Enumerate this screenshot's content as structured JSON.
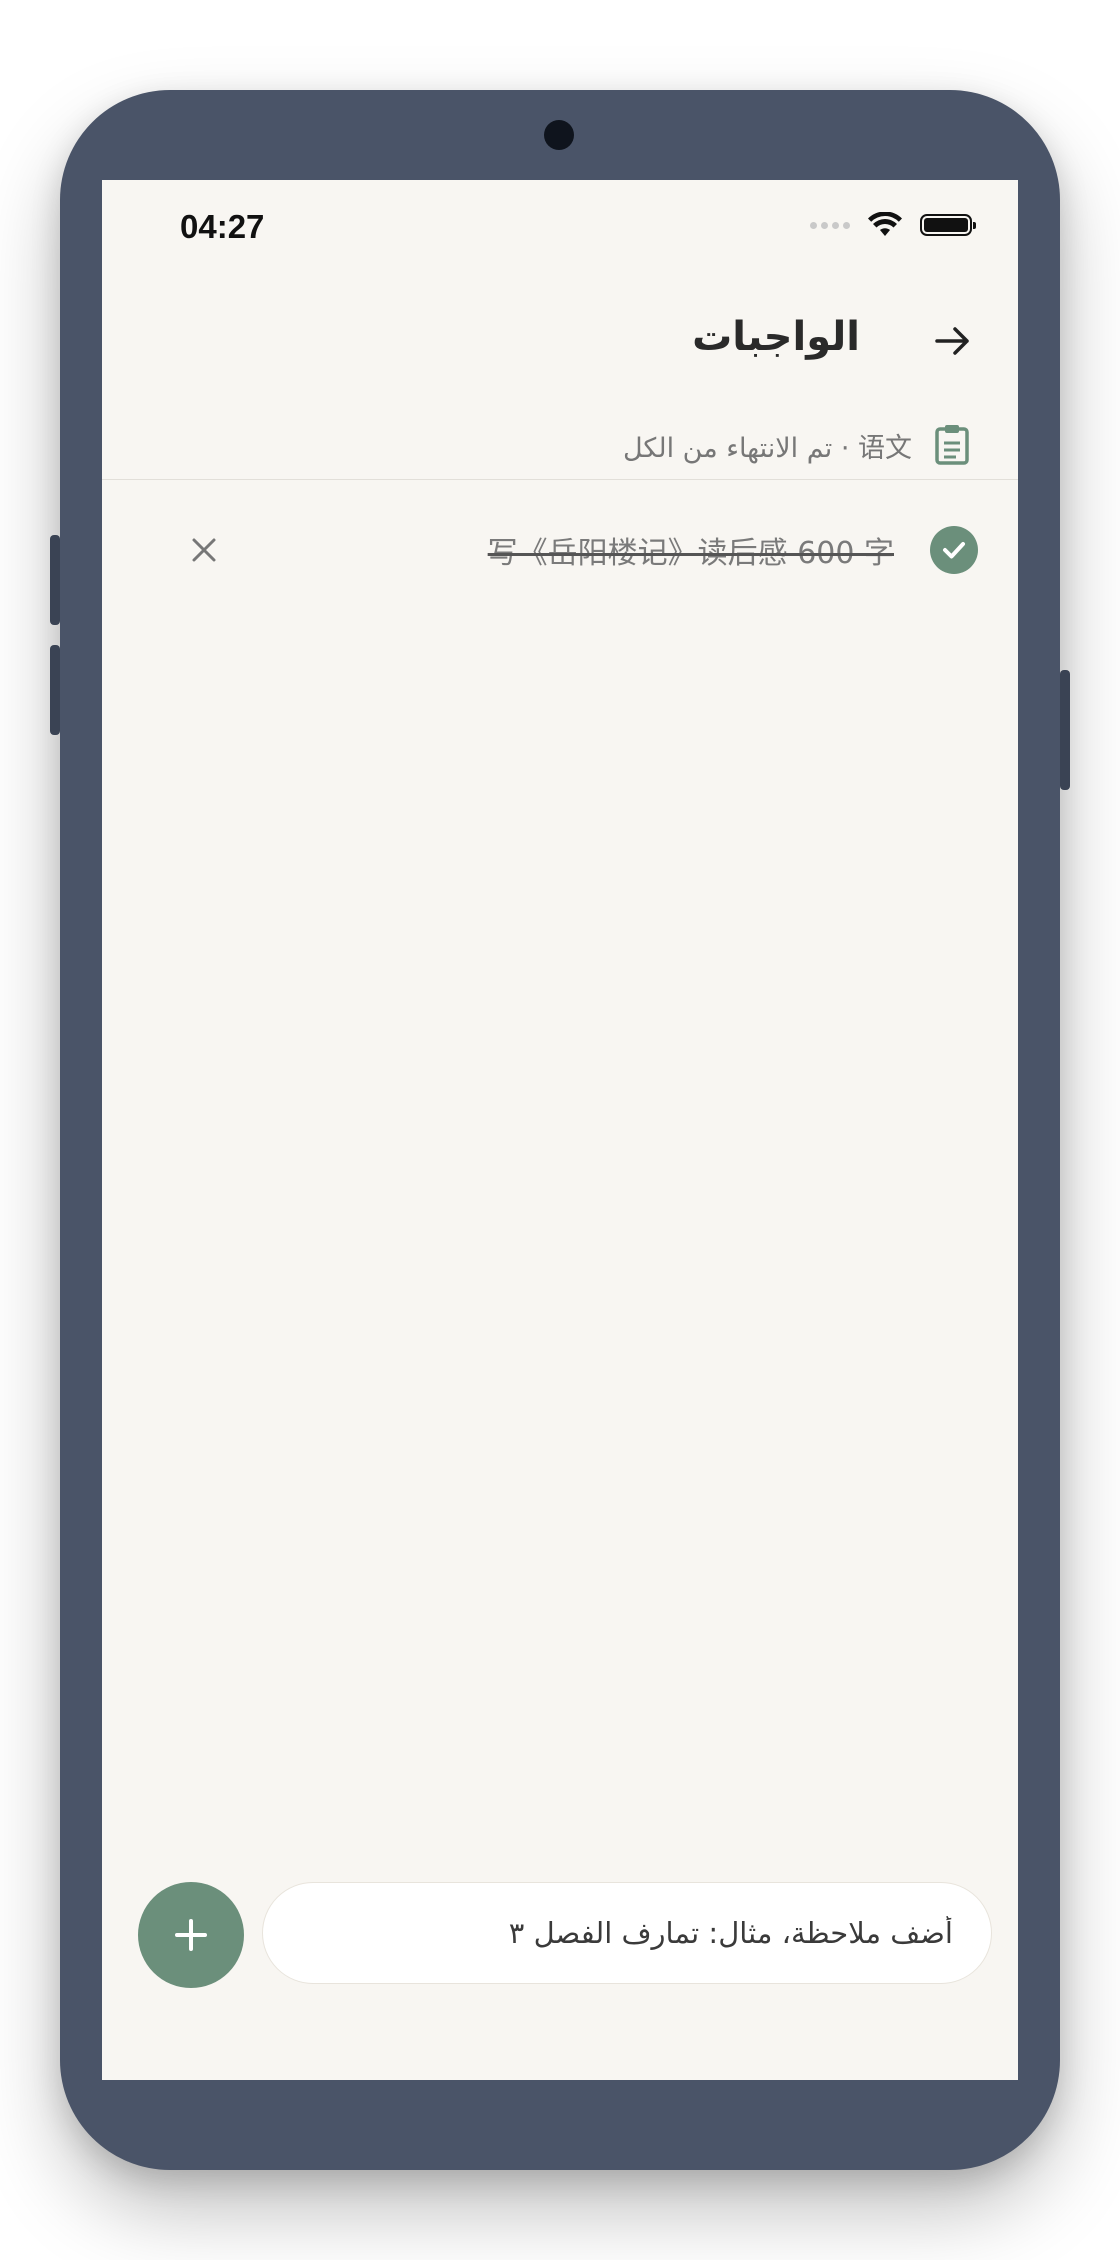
{
  "status_bar": {
    "time": "04:27"
  },
  "header": {
    "title": "الواجبات",
    "back_icon": "arrow-right-icon"
  },
  "subtitle": {
    "icon": "clipboard-icon",
    "text": "语文 · تم الانتهاء من الكل"
  },
  "tasks": [
    {
      "text": "写《岳阳楼记》读后感 600 字",
      "completed": true
    }
  ],
  "composer": {
    "placeholder": "أضف ملاحظة، مثال: تمارف الفصل ٣",
    "add_icon": "plus-icon"
  },
  "colors": {
    "accent": "#6b8f7b",
    "background": "#f8f6f2",
    "device_frame": "#4a5468"
  }
}
